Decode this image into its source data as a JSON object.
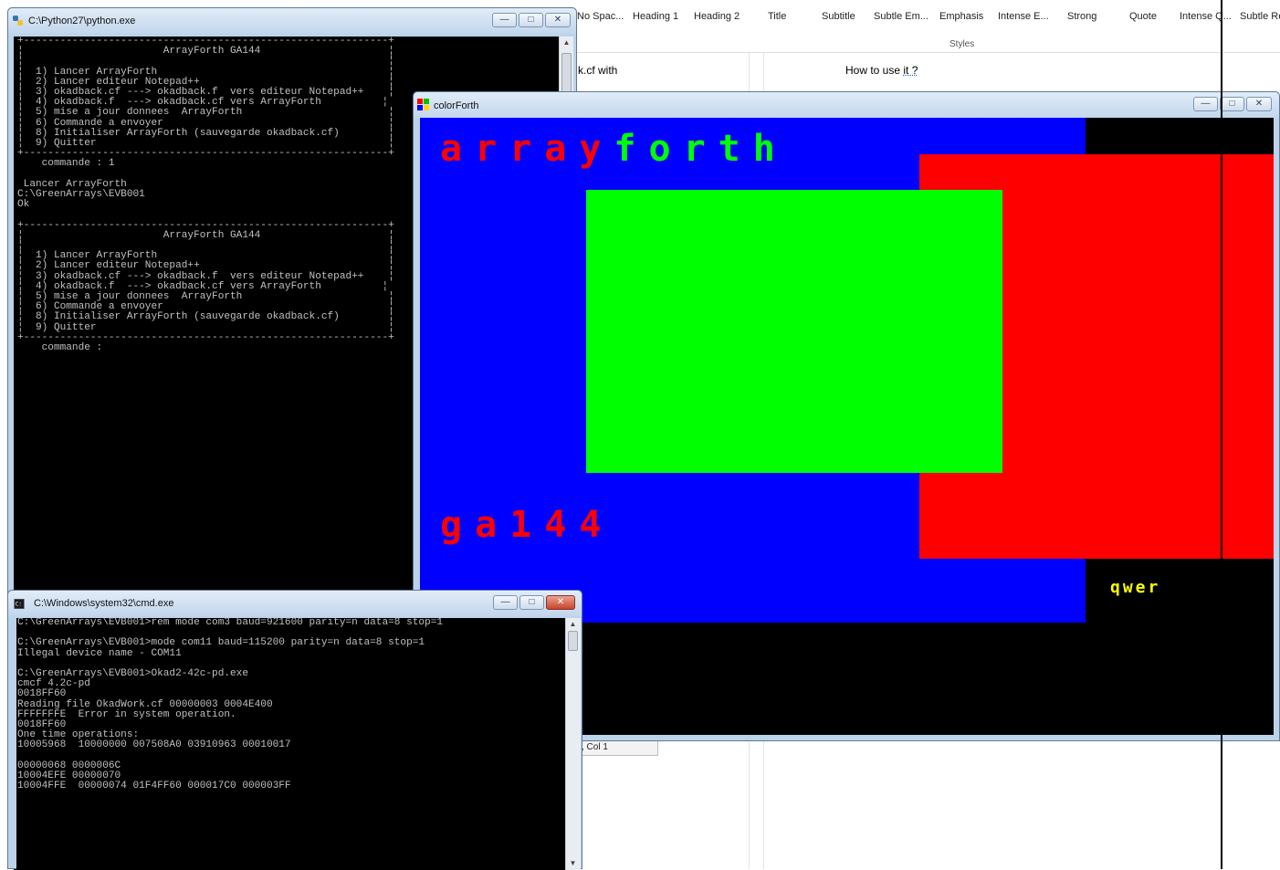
{
  "word": {
    "styles": [
      "No Spac...",
      "Heading 1",
      "Heading 2",
      "Title",
      "Subtitle",
      "Subtle Em...",
      "Emphasis",
      "Intense E...",
      "Strong",
      "Quote",
      "Intense Q...",
      "Subtle Re"
    ],
    "styles_caption": "Styles",
    "doc_left_text": "k.cf with",
    "doc_right_pre": "How to use ",
    "doc_right_spell": "it ?",
    "status_text": ", Col 1"
  },
  "python_window": {
    "title": "C:\\Python27\\python.exe",
    "console_text": "+------------------------------------------------------------+\n¦                       ArrayForth GA144                     ¦\n¦                                                            ¦\n¦  1) Lancer ArrayForth                                      ¦\n¦  2) Lancer editeur Notepad++                               ¦\n¦  3) okadback.cf ---> okadback.f  vers editeur Notepad++    ¦\n¦  4) okadback.f  ---> okadback.cf vers ArrayForth          ¦\n¦  5) mise a jour donnees  ArrayForth                        ¦\n¦  6) Commande a envoyer                                     ¦\n¦  8) Initialiser ArrayForth (sauvegarde okadback.cf)        ¦\n¦  9) Quitter                                                ¦\n+------------------------------------------------------------+\n    commande : 1\n\n Lancer ArrayForth\nC:\\GreenArrays\\EVB001\nOk\n\n+------------------------------------------------------------+\n¦                       ArrayForth GA144                     ¦\n¦                                                            ¦\n¦  1) Lancer ArrayForth                                      ¦\n¦  2) Lancer editeur Notepad++                               ¦\n¦  3) okadback.cf ---> okadback.f  vers editeur Notepad++    ¦\n¦  4) okadback.f  ---> okadback.cf vers ArrayForth          ¦\n¦  5) mise a jour donnees  ArrayForth                        ¦\n¦  6) Commande a envoyer                                     ¦\n¦  8) Initialiser ArrayForth (sauvegarde okadback.cf)        ¦\n¦  9) Quitter                                                ¦\n+------------------------------------------------------------+\n    commande :"
  },
  "colorforth_window": {
    "title": "colorForth",
    "text_array": "array",
    "text_forth": "forth",
    "text_ga144": "ga144",
    "text_qwer": "qwer",
    "colors": {
      "blue": "#0000ff",
      "red": "#ff0000",
      "green": "#00ff00",
      "yellow": "#ffff00",
      "black": "#000000"
    }
  },
  "cmd_window": {
    "title": "C:\\Windows\\system32\\cmd.exe",
    "console_text": "C:\\GreenArrays\\EVB001>rem mode com3 baud=921600 parity=n data=8 stop=1\n\nC:\\GreenArrays\\EVB001>mode com11 baud=115200 parity=n data=8 stop=1\nIllegal device name - COM11\n\nC:\\GreenArrays\\EVB001>Okad2-42c-pd.exe\ncmcf 4.2c-pd\n0018FF60\nReading file OkadWork.cf 00000003 0004E400\nFFFFFFFE  Error in system operation.\n0018FF60\nOne time operations:\n10005968  10000000 007508A0 03910963 00010017\n\n00000068 0000006C\n10004EFE 00000070\n10004FFE  00000074 01F4FF60 000017C0 000003FF"
  }
}
